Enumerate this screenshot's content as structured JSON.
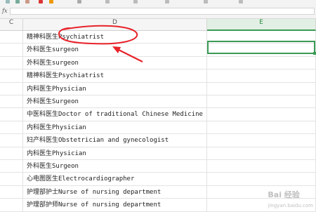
{
  "formula_bar": {
    "fx_label": "fx",
    "value": ""
  },
  "columns": [
    "C",
    "D",
    "E"
  ],
  "rows": [
    "精神科医生Psychiatrist",
    "外科医生surgeon",
    "外科医生surgeon",
    "精神科医生Psychiatrist",
    "内科医生Physician",
    "外科医生Surgeon",
    "中医科医生Doctor of traditional Chinese Medicine",
    "内科医生Physician",
    "妇产科医生Obstetrician and gynecologist",
    "内科医生Physician",
    "外科医生Surgeon",
    "心电图医生Electrocardiographer",
    "护理部护士Nurse of nursing department",
    "护理部护师Nurse of nursing department"
  ],
  "accent_color": "#3a9b55",
  "annotation_color": "#e8232a",
  "watermark": {
    "main": "Bai 经验",
    "sub": "jingyan.baidu.com"
  }
}
